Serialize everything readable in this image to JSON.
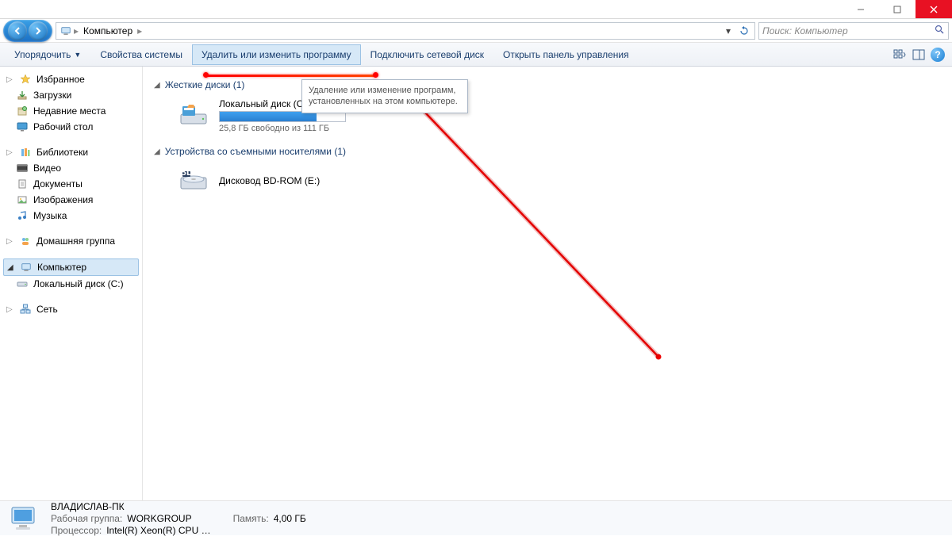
{
  "window": {
    "minimize": "—",
    "maximize": "▢",
    "close": "✕"
  },
  "breadcrumb": {
    "root": "Компьютер"
  },
  "search": {
    "placeholder": "Поиск: Компьютер"
  },
  "toolbar": {
    "organize": "Упорядочить",
    "properties": "Свойства системы",
    "uninstall": "Удалить или изменить программу",
    "map_drive": "Подключить сетевой диск",
    "control_panel": "Открыть панель управления"
  },
  "tooltip": {
    "text": "Удаление или изменение программ, установленных на этом компьютере."
  },
  "sidebar": {
    "favorites": "Избранное",
    "downloads": "Загрузки",
    "recent": "Недавние места",
    "desktop": "Рабочий стол",
    "libraries": "Библиотеки",
    "videos": "Видео",
    "documents": "Документы",
    "pictures": "Изображения",
    "music": "Музыка",
    "homegroup": "Домашняя группа",
    "computer": "Компьютер",
    "local_disk": "Локальный диск (C:)",
    "network": "Сеть"
  },
  "main": {
    "hdd_header": "Жесткие диски (1)",
    "local_disk_name": "Локальный диск (C:)",
    "local_disk_free": "25,8 ГБ свободно из 111 ГБ",
    "disk_fill_pct": 77,
    "removable_header": "Устройства со съемными носителями (1)",
    "bdrom_name": "Дисковод BD-ROM (E:)"
  },
  "status": {
    "pc_name": "ВЛАДИСЛАВ-ПК",
    "workgroup_label": "Рабочая группа:",
    "workgroup": "WORKGROUP",
    "cpu_label": "Процессор:",
    "cpu": "Intel(R) Xeon(R) CPU    …",
    "mem_label": "Память:",
    "mem": "4,00 ГБ"
  }
}
